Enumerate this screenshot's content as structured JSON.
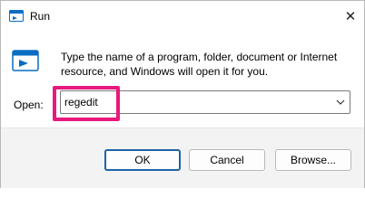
{
  "window": {
    "title": "Run",
    "close_glyph": "✕"
  },
  "main": {
    "description": "Type the name of a program, folder, document or Internet resource, and Windows will open it for you.",
    "open_label": "Open:",
    "open_value": "regedit"
  },
  "buttons": {
    "ok": "OK",
    "cancel": "Cancel",
    "browse": "Browse..."
  },
  "icons": {
    "app": "run-icon",
    "description": "run-icon",
    "dropdown": "chevron-down-icon",
    "close": "close-icon"
  },
  "colors": {
    "highlight": "#e8197e",
    "accent": "#1e63a6",
    "footer_bg": "#f3f3f3"
  }
}
